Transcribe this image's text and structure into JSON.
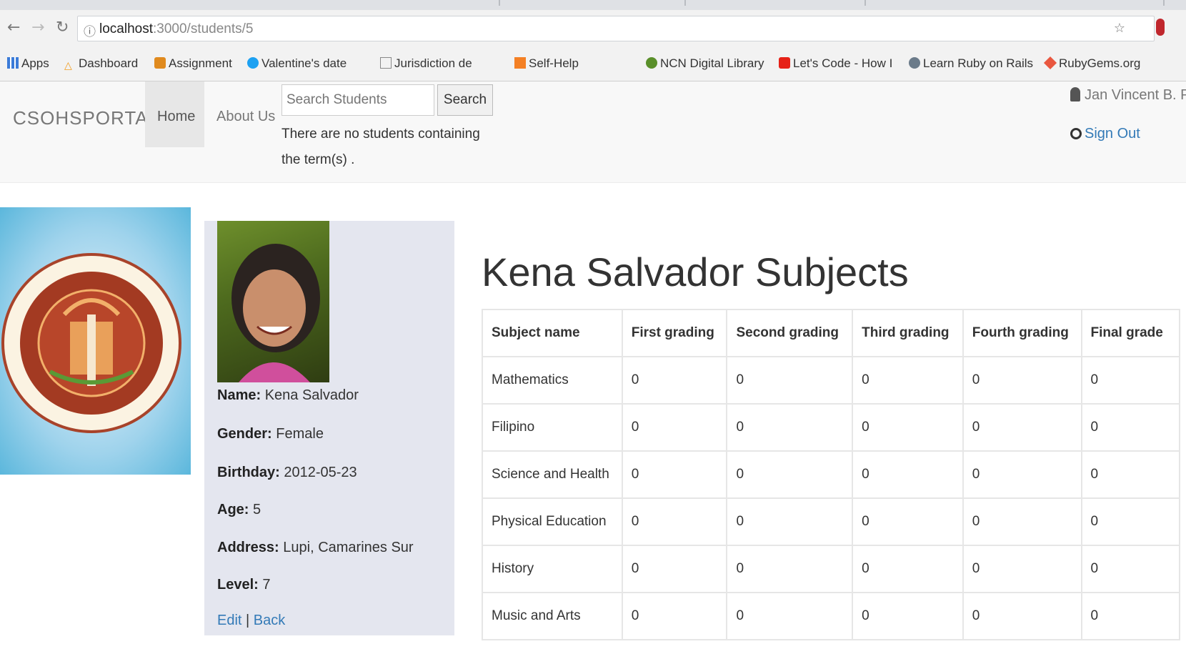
{
  "browser": {
    "url_host": "localhost",
    "url_path": ":3000/students/5",
    "bookmarks": [
      "Apps",
      "Dashboard",
      "Assignment",
      "Valentine's date",
      "Jurisdiction de",
      "Self-Help",
      "NCN Digital Library",
      "Let's Code - How I",
      "Learn Ruby on Rails",
      "RubyGems.org"
    ]
  },
  "navbar": {
    "brand": "CSOHSPORTAL",
    "home": "Home",
    "about": "About Us",
    "search_placeholder": "Search Students",
    "search_button": "Search",
    "search_message": "There are no students containing the term(s) .",
    "user": "Jan Vincent B. Pa",
    "signout": "Sign Out"
  },
  "profile": {
    "name_label": "Name:",
    "name": "Kena Salvador",
    "gender_label": "Gender:",
    "gender": "Female",
    "birthday_label": "Birthday:",
    "birthday": "2012-05-23",
    "age_label": "Age:",
    "age": "5",
    "address_label": "Address:",
    "address": "Lupi, Camarines Sur",
    "level_label": "Level:",
    "level": "7",
    "edit": "Edit",
    "separator": "|",
    "back": "Back"
  },
  "main": {
    "title": "Kena Salvador Subjects",
    "columns": [
      "Subject name",
      "First grading",
      "Second grading",
      "Third grading",
      "Fourth grading",
      "Final grade"
    ],
    "rows": [
      [
        "Mathematics",
        "0",
        "0",
        "0",
        "0",
        "0"
      ],
      [
        "Filipino",
        "0",
        "0",
        "0",
        "0",
        "0"
      ],
      [
        "Science and Health",
        "0",
        "0",
        "0",
        "0",
        "0"
      ],
      [
        "Physical Education",
        "0",
        "0",
        "0",
        "0",
        "0"
      ],
      [
        "History",
        "0",
        "0",
        "0",
        "0",
        "0"
      ],
      [
        "Music and Arts",
        "0",
        "0",
        "0",
        "0",
        "0"
      ]
    ]
  },
  "colors": {
    "link": "#337ab7",
    "panel": "#e4e6ef",
    "navbar": "#f8f8f8"
  }
}
